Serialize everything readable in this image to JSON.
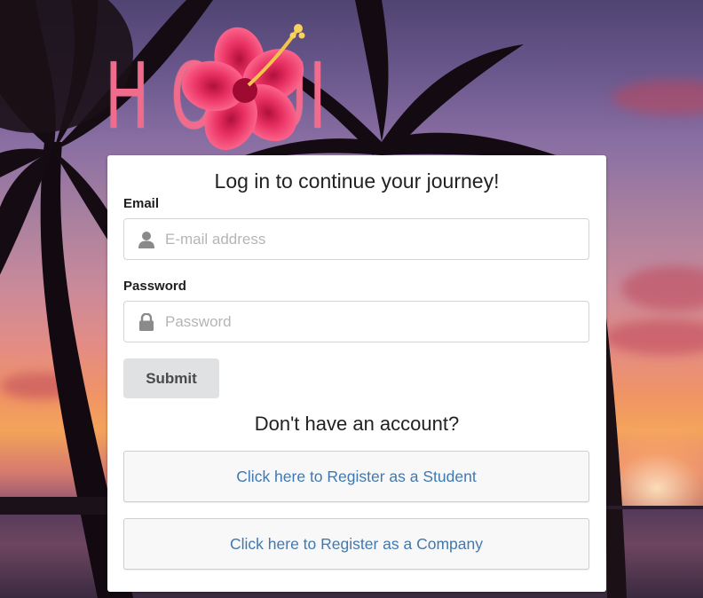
{
  "logo": {
    "text": "H  OHUI",
    "flower_icon": "hibiscus-flower-icon",
    "color": "#f06b8c"
  },
  "login": {
    "title": "Log in to continue your journey!",
    "email_label": "Email",
    "email_placeholder": "E-mail address",
    "email_icon": "user-icon",
    "password_label": "Password",
    "password_placeholder": "Password",
    "password_icon": "lock-icon",
    "submit_label": "Submit"
  },
  "register": {
    "prompt": "Don't have an account?",
    "student_label": "Click here to Register as a Student",
    "company_label": "Click here to Register as a Company",
    "link_color": "#4178b0"
  }
}
